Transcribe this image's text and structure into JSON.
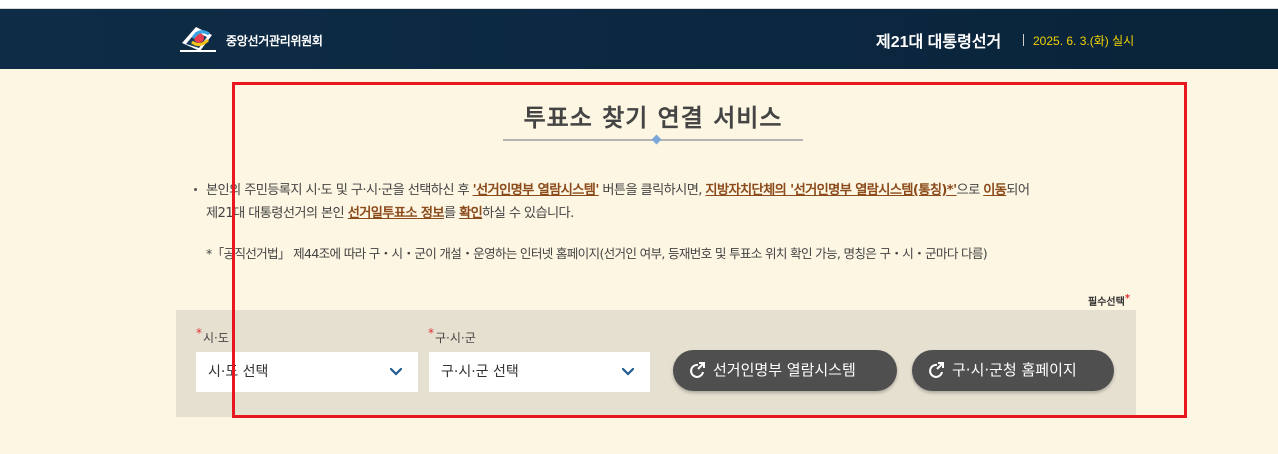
{
  "header": {
    "org_name": "중앙선거관리위원회",
    "election_title": "제21대 대통령선거",
    "election_date": "2025. 6. 3.(화) 실시"
  },
  "main": {
    "title": "투표소 찾기 연결 서비스",
    "desc": {
      "p1": "본인의 주민등록지 시·도 및 구·시·군을 선택하신 후 ",
      "l1": "'선거인명부 열람시스템'",
      "p2": " 버튼을 클릭하시면, ",
      "l2": "지방자치단체의 '선거인명부 열람시스템(통칭)*'",
      "p3": "으로 ",
      "l3": "이동",
      "p4": "되어",
      "p5": "제21대 대통령선거의 본인 ",
      "l4": "선거일투표소 정보",
      "p6": "를 ",
      "l5": "확인",
      "p7": "하실 수 있습니다."
    },
    "note": "*「공직선거법」 제44조에 따라 구・시・군이 개설・운영하는 인터넷 홈페이지(선거인 여부, 등재번호 및 투표소 위치 확인 가능, 명칭은 구・시・군마다 다름)",
    "required_label": "필수선택",
    "required_mark": "*"
  },
  "form": {
    "sido_label": "시·도",
    "sido_value": "시·도 선택",
    "gusigun_label": "구·시·군",
    "gusigun_value": "구·시·군 선택",
    "btn_registry": "선거인명부 열람시스템",
    "btn_homepage": "구·시·군청 홈페이지"
  },
  "colors": {
    "header_bg": "#0f2c46",
    "date_text": "#f2d200",
    "link_text": "#8b4a1a",
    "button_bg": "#4f4f4f",
    "panel_bg": "#e6e0d1",
    "highlight_box": "#e8161e"
  },
  "icons": [
    "logo-icon",
    "chevron-down-icon",
    "external-link-icon"
  ]
}
